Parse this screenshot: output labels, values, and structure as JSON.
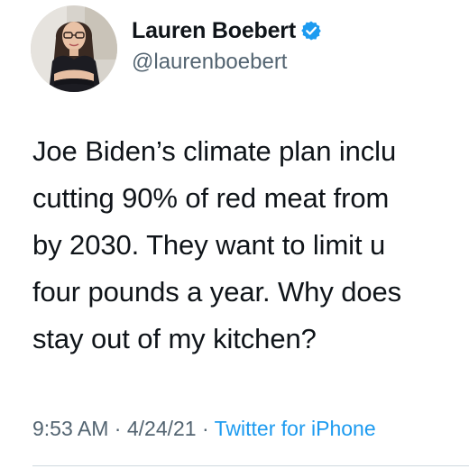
{
  "author": {
    "display_name": "Lauren Boebert",
    "handle": "@laurenboebert",
    "verified": true,
    "avatar_icon": "profile-photo"
  },
  "tweet": {
    "lines": [
      "Joe Biden’s climate plan inclu",
      "cutting 90% of red meat from",
      "by 2030. They want to limit u",
      "four pounds a year. Why does",
      "stay out of my kitchen?"
    ]
  },
  "meta": {
    "time": "9:53 AM",
    "separator": "·",
    "date": "4/24/21",
    "source": "Twitter for iPhone"
  },
  "colors": {
    "verified_badge": "#1d9bf0",
    "link": "#1d9bf0",
    "secondary_text": "#536471"
  }
}
